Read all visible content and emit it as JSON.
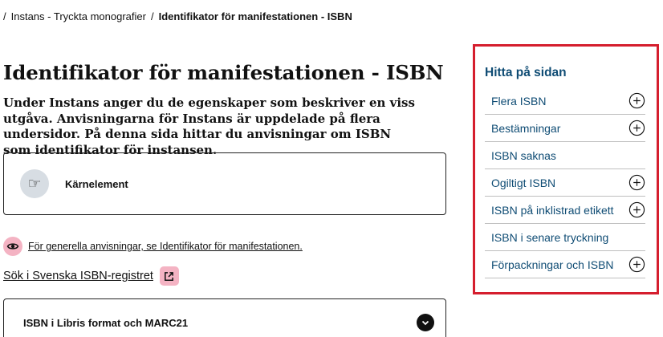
{
  "breadcrumb": {
    "separator": "/",
    "parent": "Instans - Tryckta monografier",
    "current": "Identifikator för manifestationen - ISBN"
  },
  "main": {
    "title": "Identifikator för manifestationen - ISBN",
    "lead": "Under Instans anger du de egenskaper som beskriver en viss utgåva. Anvisningarna för Instans är uppdelade på flera undersidor. På denna sida hittar du anvisningar om ISBN som identifikator för instansen.",
    "core_element": {
      "icon": "pointing-hand-icon",
      "label": "Kärnelement"
    },
    "general_link": {
      "icon": "eye-icon",
      "text": "För generella anvisningar, se Identifikator för manifestationen."
    },
    "registry_link": {
      "text": "Sök i Svenska ISBN-registret",
      "icon": "external-link-icon"
    },
    "accordion": {
      "label": "ISBN i Libris format och MARC21",
      "icon": "chevron-down-icon",
      "expanded": false
    }
  },
  "toc": {
    "heading": "Hitta på sidan",
    "items": [
      {
        "label": "Flera ISBN",
        "expandable": true
      },
      {
        "label": "Bestämningar",
        "expandable": true
      },
      {
        "label": "ISBN saknas",
        "expandable": false
      },
      {
        "label": "Ogiltigt ISBN",
        "expandable": true
      },
      {
        "label": "ISBN på inklistrad etikett",
        "expandable": true
      },
      {
        "label": "ISBN i senare tryckning",
        "expandable": false
      },
      {
        "label": "Förpackningar och ISBN",
        "expandable": true
      }
    ]
  },
  "colors": {
    "accent_text": "#0f4c74",
    "highlight_border": "#d51e2e",
    "badge_pink": "#f4b3c3",
    "core_icon_bg": "#d7dde3"
  }
}
